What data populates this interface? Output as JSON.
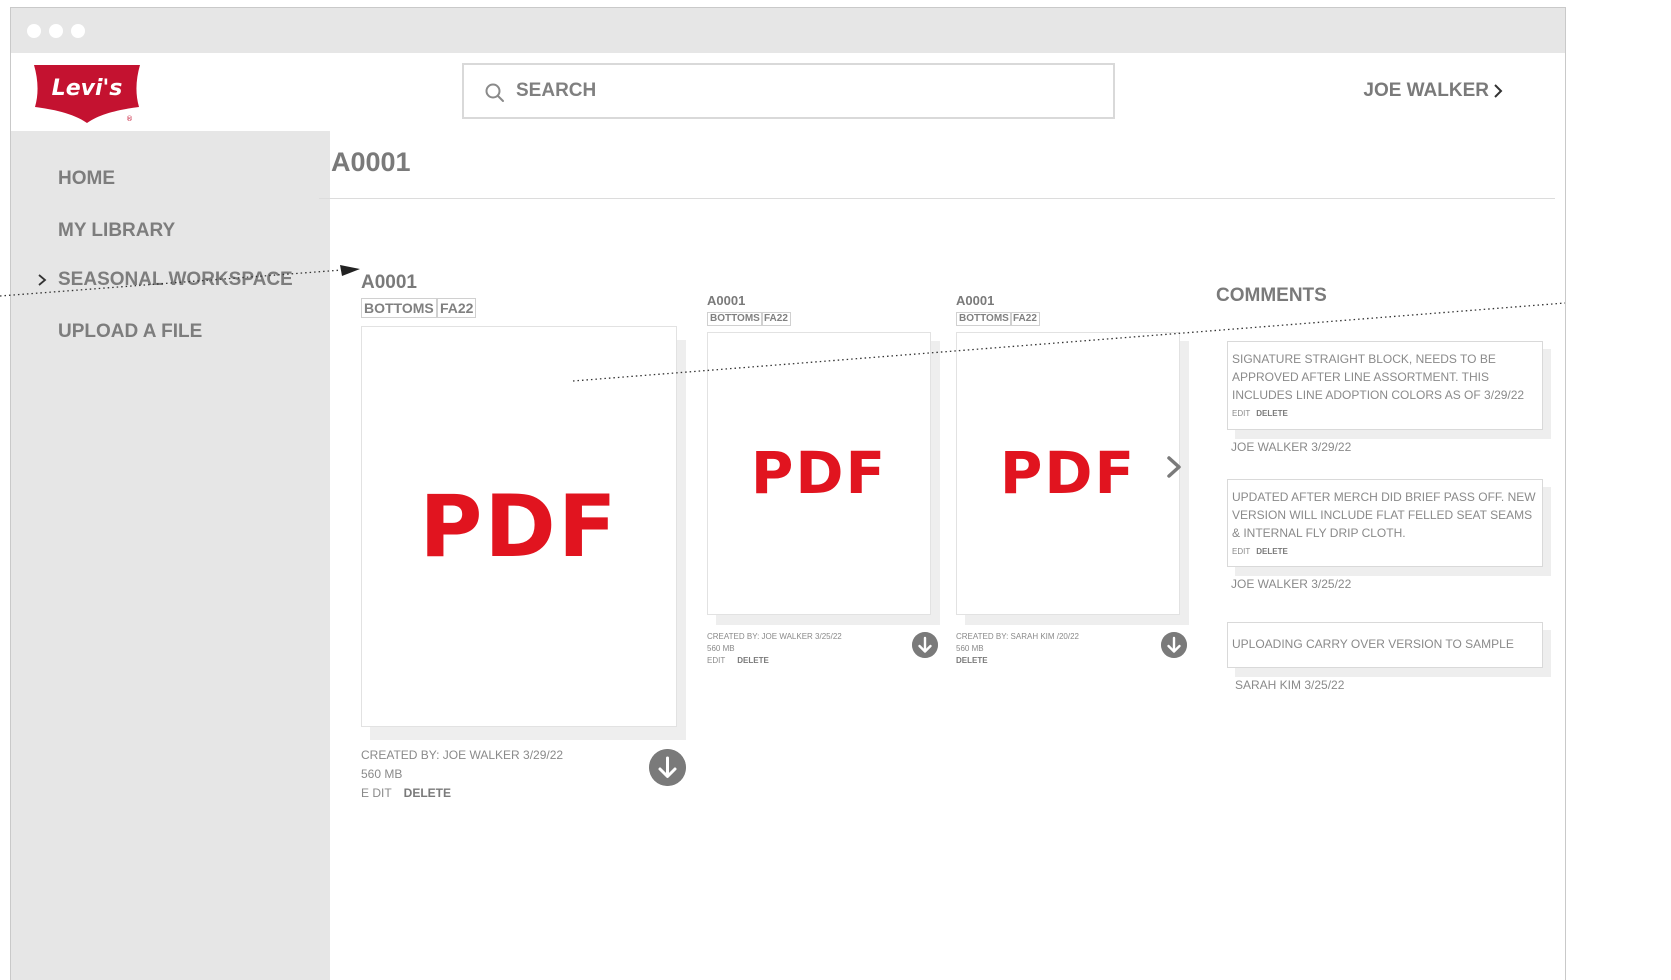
{
  "app": {
    "brand": "Levi's",
    "brand_color": "#c41230",
    "accent_color": "#e1141f"
  },
  "header": {
    "search_placeholder": "SEARCH",
    "user_name": "JOE WALKER"
  },
  "sidebar": {
    "items": [
      {
        "label": "HOME",
        "active": false
      },
      {
        "label": "MY LIBRARY",
        "active": false
      },
      {
        "label": "SEASONAL WORKSPACE",
        "active": true,
        "icon": "chevron-right-icon"
      },
      {
        "label": "UPLOAD A FILE",
        "active": false
      }
    ]
  },
  "main": {
    "title": "A0001",
    "files": [
      {
        "title": "A0001",
        "tags": [
          "BOTTOMS",
          "FA22"
        ],
        "thumbnail_label": "PDF",
        "created": "CREATED BY: JOE WALKER 3/29/22",
        "size": "560 MB",
        "edit_label": "E DIT",
        "delete_label": "DELETE",
        "icon": "download-icon"
      },
      {
        "title": "A0001",
        "tags": [
          "BOTTOMS",
          "FA22"
        ],
        "thumbnail_label": "PDF",
        "created": "CREATED BY: JOE WALKER 3/25/22",
        "size": "560 MB",
        "edit_label": "EDIT",
        "delete_label": "DELETE",
        "icon": "download-icon"
      },
      {
        "title": "A0001",
        "tags": [
          "BOTTOMS",
          "FA22"
        ],
        "thumbnail_label": "PDF",
        "created": "CREATED BY: SARAH KIM /20/22",
        "size": "560 MB",
        "delete_label": "DELETE",
        "icon": "download-icon"
      }
    ],
    "next_icon": "chevron-right-icon"
  },
  "comments": {
    "title": "COMMENTS",
    "items": [
      {
        "text": "SIGNATURE STRAIGHT BLOCK, NEEDS TO BE APPROVED AFTER LINE ASSORTMENT. THIS INCLUDES LINE ADOPTION COLORS AS OF 3/29/22",
        "edit_label": "EDIT",
        "delete_label": "DELETE",
        "author": "JOE WALKER 3/29/22"
      },
      {
        "text": "UPDATED AFTER MERCH DID BRIEF PASS OFF. NEW VERSION WILL INCLUDE FLAT FELLED SEAT SEAMS & INTERNAL FLY DRIP CLOTH.",
        "edit_label": "EDIT",
        "delete_label": "DELETE",
        "author": "JOE WALKER 3/25/22"
      },
      {
        "text": "UPLOADING CARRY OVER VERSION TO SAMPLE",
        "author": "SARAH KIM  3/25/22"
      }
    ]
  }
}
